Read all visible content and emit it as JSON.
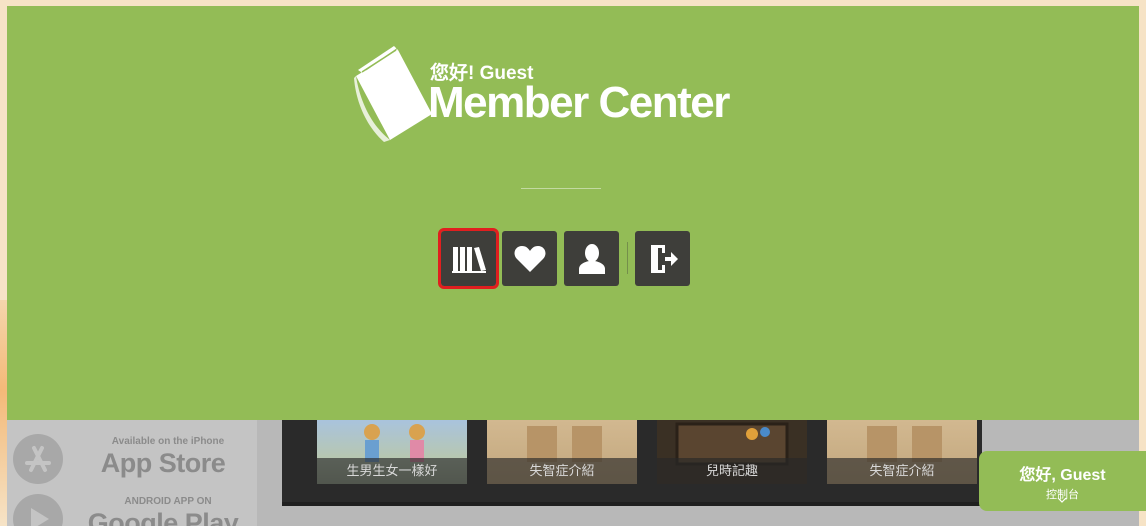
{
  "hero": {
    "greeting": "您好! Guest",
    "title": "Member Center",
    "bg_color": "#93bc56",
    "buttons": [
      {
        "name": "bookshelf",
        "icon": "books-icon",
        "selected": true
      },
      {
        "name": "favorites",
        "icon": "heart-icon",
        "selected": false
      },
      {
        "name": "profile",
        "icon": "user-icon",
        "selected": false
      },
      {
        "name": "logout",
        "icon": "logout-icon",
        "selected": false
      }
    ],
    "selected_outline_color": "#e01f1f"
  },
  "app_badges": {
    "app_store_small": "Available on the iPhone",
    "app_store_big": "App Store",
    "google_play_small": "ANDROID APP ON",
    "google_play_big": "Google Play"
  },
  "gallery": {
    "items": [
      {
        "caption": "生男生女一樣好"
      },
      {
        "caption": "失智症介紹"
      },
      {
        "caption": "兒時記趣"
      },
      {
        "caption": "失智症介紹"
      }
    ]
  },
  "console": {
    "greeting": "您好, Guest",
    "label": "控制台"
  }
}
